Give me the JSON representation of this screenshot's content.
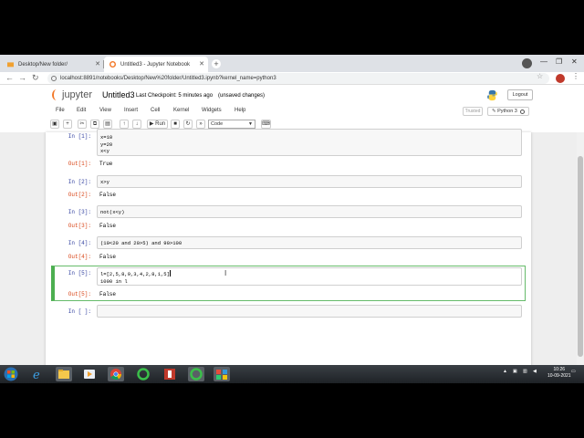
{
  "browser": {
    "tabs": [
      {
        "label": "Desktop/New folder/",
        "active": false
      },
      {
        "label": "Untitled3 - Jupyter Notebook",
        "active": true
      }
    ],
    "url": "localhost:8891/notebooks/Desktop/New%20folder/Untitled3.ipynb?kernel_name=python3"
  },
  "jupyter": {
    "logo_text": "jupyter",
    "notebook_name": "Untitled3",
    "checkpoint": "Last Checkpoint: 5 minutes ago",
    "unsaved": "(unsaved changes)",
    "logout_label": "Logout",
    "menu": [
      "File",
      "Edit",
      "View",
      "Insert",
      "Cell",
      "Kernel",
      "Widgets",
      "Help"
    ],
    "trusted_label": "Trusted",
    "kernel_name": "Python 3",
    "run_label": "Run",
    "cell_type": "Code"
  },
  "cells": [
    {
      "in_prompt": "In [1]:",
      "code": "x=10\ny=20\nx<y",
      "out_prompt": "Out[1]:",
      "output": "True"
    },
    {
      "in_prompt": "In [2]:",
      "code": "x>y",
      "out_prompt": "Out[2]:",
      "output": "False"
    },
    {
      "in_prompt": "In [3]:",
      "code": "not(x<y)",
      "out_prompt": "Out[3]:",
      "output": "False"
    },
    {
      "in_prompt": "In [4]:",
      "code": "(10<20 and 20>5) and 90>100",
      "out_prompt": "Out[4]:",
      "output": "False"
    },
    {
      "in_prompt": "In [5]:",
      "code_line1": "l=[2,5,8,9,3,4,2,8,1,5]",
      "code_line2": "1000 in l",
      "out_prompt": "Out[5]:",
      "output": "False"
    },
    {
      "in_prompt": "In [ ]:"
    }
  ],
  "taskbar": {
    "clock_time": "10:26",
    "clock_date": "10-09-2021"
  },
  "colors": {
    "jupyter_orange": "#f37726",
    "in_prompt": "#303f9f",
    "out_prompt": "#d84315",
    "selected_border": "#4caf50"
  }
}
